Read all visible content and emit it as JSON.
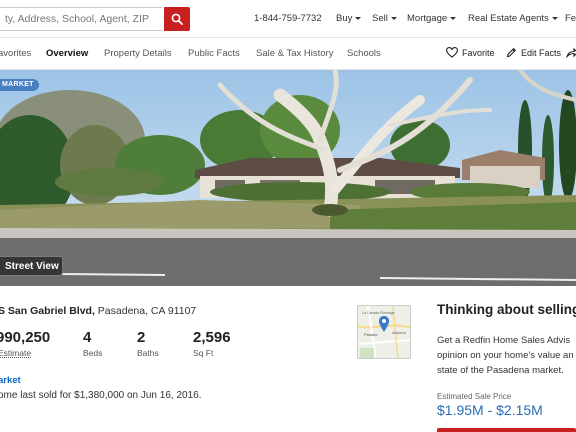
{
  "header": {
    "search_placeholder": "ty, Address, School, Agent, ZIP",
    "phone": "1-844-759-7732",
    "nav": [
      {
        "label": "Buy"
      },
      {
        "label": "Sell"
      },
      {
        "label": "Mortgage"
      },
      {
        "label": "Real Estate Agents"
      },
      {
        "label": "Fe"
      }
    ]
  },
  "tabs": {
    "items": [
      {
        "label": "avorites"
      },
      {
        "label": "Overview",
        "active": true
      },
      {
        "label": "Property Details"
      },
      {
        "label": "Public Facts"
      },
      {
        "label": "Sale & Tax History"
      },
      {
        "label": "Schools"
      }
    ],
    "favorite_label": "Favorite",
    "edit_facts_label": "Edit Facts"
  },
  "photo": {
    "badge": "MARKET",
    "street_view_label": "Street View"
  },
  "property": {
    "street": "S San Gabriel Blvd,",
    "city_line": "Pasadena, CA 91107",
    "price": "990,250",
    "price_label": "Estimate",
    "beds": "4",
    "beds_label": "Beds",
    "baths": "2",
    "baths_label": "Baths",
    "sqft": "2,596",
    "sqft_label": "Sq Ft",
    "market_link": "arket",
    "sold_text": "ome last sold for $1,380,000 on Jun 16, 2016."
  },
  "map": {
    "label_top": "La Canada Flintridge",
    "label_city": "Pasade",
    "label_side": "Altadena"
  },
  "sell_panel": {
    "title": "Thinking about selling",
    "line1": "Get a Redfin Home Sales Advis",
    "line2": "opinion on your home’s value an",
    "line3": "state of the Pasadena market.",
    "estimate_label": "Estimated Sale Price",
    "estimate_range": "$1.95M - $2.15M"
  },
  "colors": {
    "brand_red": "#c82021",
    "link_blue": "#0a66c2",
    "badge_blue": "#4a7fc4",
    "estimate_blue": "#2b6cb5"
  }
}
